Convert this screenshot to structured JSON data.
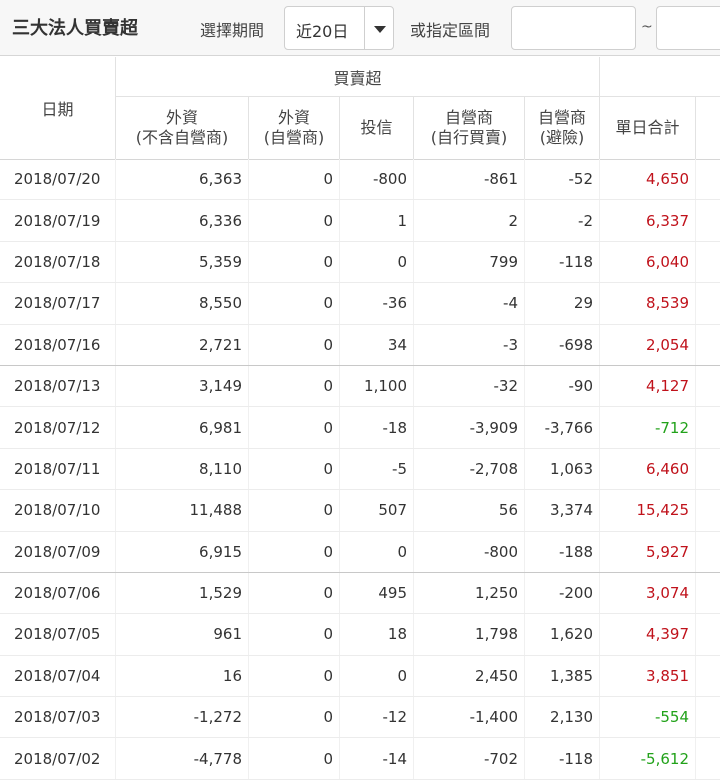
{
  "toolbar": {
    "title": "三大法人買賣超",
    "period_label": "選擇期間",
    "period_value": "近20日",
    "range_label": "或指定區間",
    "range_sep": "~",
    "start_value": "",
    "end_value": ""
  },
  "table": {
    "group_header": "買賣超",
    "date_header": "日期",
    "columns": [
      {
        "line1": "外資",
        "line2": "(不含自營商)"
      },
      {
        "line1": "外資",
        "line2": "(自營商)"
      },
      {
        "line1": "投信",
        "line2": ""
      },
      {
        "line1": "自營商",
        "line2": "(自行買賣)"
      },
      {
        "line1": "自營商",
        "line2": "(避險)"
      },
      {
        "line1": "單日合計",
        "line2": ""
      }
    ],
    "rows": [
      {
        "date": "2018/07/20",
        "v": [
          "6,363",
          "0",
          "-800",
          "-861",
          "-52",
          "4,650"
        ]
      },
      {
        "date": "2018/07/19",
        "v": [
          "6,336",
          "0",
          "1",
          "2",
          "-2",
          "6,337"
        ]
      },
      {
        "date": "2018/07/18",
        "v": [
          "5,359",
          "0",
          "0",
          "799",
          "-118",
          "6,040"
        ]
      },
      {
        "date": "2018/07/17",
        "v": [
          "8,550",
          "0",
          "-36",
          "-4",
          "29",
          "8,539"
        ]
      },
      {
        "date": "2018/07/16",
        "v": [
          "2,721",
          "0",
          "34",
          "-3",
          "-698",
          "2,054"
        ]
      },
      {
        "date": "2018/07/13",
        "v": [
          "3,149",
          "0",
          "1,100",
          "-32",
          "-90",
          "4,127"
        ]
      },
      {
        "date": "2018/07/12",
        "v": [
          "6,981",
          "0",
          "-18",
          "-3,909",
          "-3,766",
          "-712"
        ]
      },
      {
        "date": "2018/07/11",
        "v": [
          "8,110",
          "0",
          "-5",
          "-2,708",
          "1,063",
          "6,460"
        ]
      },
      {
        "date": "2018/07/10",
        "v": [
          "11,488",
          "0",
          "507",
          "56",
          "3,374",
          "15,425"
        ]
      },
      {
        "date": "2018/07/09",
        "v": [
          "6,915",
          "0",
          "0",
          "-800",
          "-188",
          "5,927"
        ]
      },
      {
        "date": "2018/07/06",
        "v": [
          "1,529",
          "0",
          "495",
          "1,250",
          "-200",
          "3,074"
        ]
      },
      {
        "date": "2018/07/05",
        "v": [
          "961",
          "0",
          "18",
          "1,798",
          "1,620",
          "4,397"
        ]
      },
      {
        "date": "2018/07/04",
        "v": [
          "16",
          "0",
          "0",
          "2,450",
          "1,385",
          "3,851"
        ]
      },
      {
        "date": "2018/07/03",
        "v": [
          "-1,272",
          "0",
          "-12",
          "-1,400",
          "2,130",
          "-554"
        ]
      },
      {
        "date": "2018/07/02",
        "v": [
          "-4,778",
          "0",
          "-14",
          "-702",
          "-118",
          "-5,612"
        ]
      }
    ]
  },
  "colors": {
    "positive_total": "#c0121b",
    "negative_total": "#22a21a"
  }
}
